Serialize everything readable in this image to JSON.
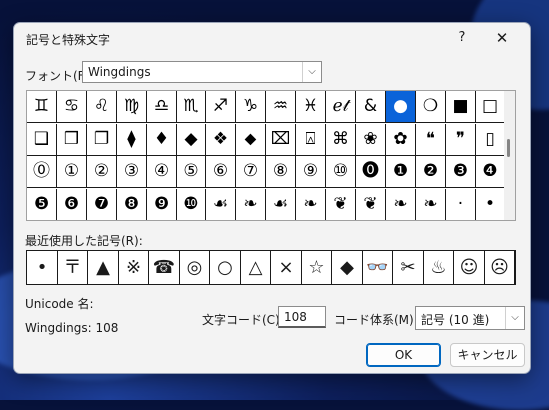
{
  "dialog": {
    "title": "記号と特殊文字",
    "help_label": "?",
    "close_label": "✕"
  },
  "font": {
    "label": "フォント(F):",
    "value": "Wingdings"
  },
  "grid": {
    "rows": [
      [
        "♊",
        "♋",
        "♌",
        "♍",
        "♎",
        "♏",
        "♐",
        "♑",
        "♒",
        "♓",
        "ℯ𝓉",
        "&",
        "●",
        "❍",
        "■",
        "□"
      ],
      [
        "❑",
        "❒",
        "❐",
        "⧫",
        "♦",
        "◆",
        "❖",
        "⬥",
        "⌧",
        "⍓",
        "⌘",
        "❀",
        "✿",
        "❝",
        "❞",
        "▯"
      ],
      [
        "⓪",
        "①",
        "②",
        "③",
        "④",
        "⑤",
        "⑥",
        "⑦",
        "⑧",
        "⑨",
        "⑩",
        "⓿",
        "❶",
        "❷",
        "❸",
        "❹"
      ],
      [
        "❺",
        "❻",
        "❼",
        "❽",
        "❾",
        "❿",
        "☙",
        "❧",
        "☙",
        "❧",
        "❦",
        "❦",
        "❧",
        "❧",
        "·",
        "•"
      ]
    ],
    "selected_index": 12
  },
  "recent": {
    "label": "最近使用した記号(R):",
    "items": [
      "•",
      "〒",
      "▲",
      "※",
      "☎",
      "◎",
      "○",
      "△",
      "×",
      "☆",
      "◆",
      "👓",
      "✂",
      "♨",
      "☺",
      "☹"
    ]
  },
  "unicode_name_label": "Unicode 名:",
  "char_code_text": "Wingdings: 108",
  "code": {
    "label": "文字コード(C):",
    "value": "108"
  },
  "code_system": {
    "label": "コード体系(M):",
    "value": "記号 (10 進)"
  },
  "buttons": {
    "ok": "OK",
    "cancel": "キャンセル"
  }
}
